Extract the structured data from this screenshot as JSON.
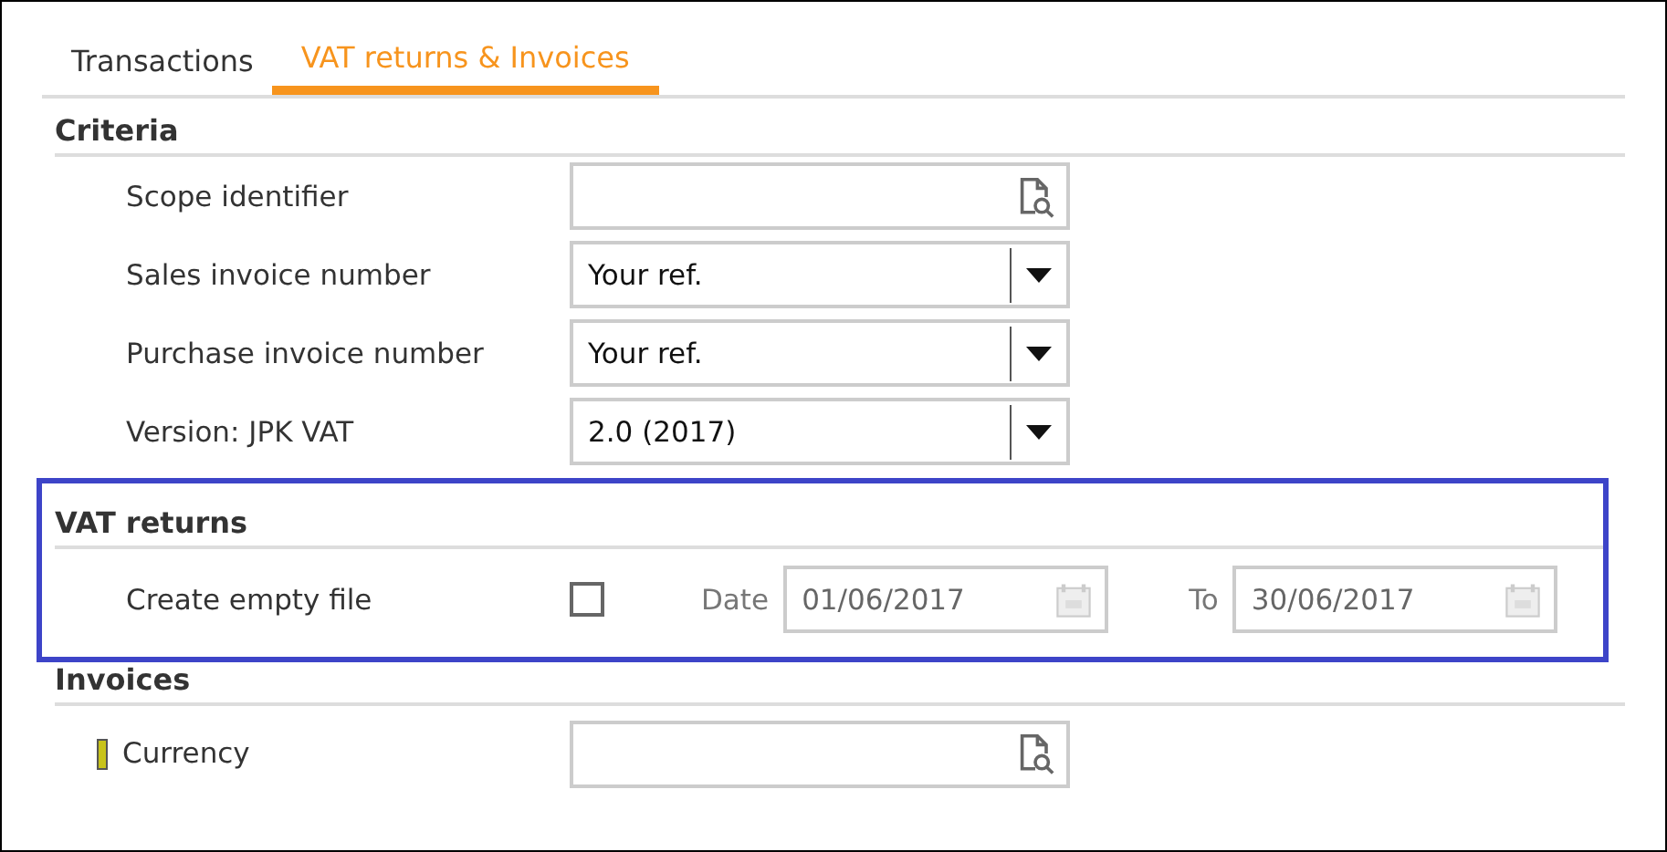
{
  "tabs": [
    {
      "label": "Transactions",
      "selected": false
    },
    {
      "label": "VAT returns & Invoices",
      "selected": true
    }
  ],
  "criteria": {
    "heading": "Criteria",
    "rows": [
      {
        "label": "Scope identifier",
        "kind": "lookup",
        "mandatory": false
      },
      {
        "label": "Sales invoice number",
        "kind": "dropdown",
        "value": "Your ref.",
        "mandatory": false
      },
      {
        "label": "Purchase invoice number",
        "kind": "dropdown",
        "value": "Your ref.",
        "mandatory": false
      },
      {
        "label": "Version: JPK VAT",
        "kind": "dropdown",
        "value": "2.0 (2017)",
        "mandatory": false
      }
    ]
  },
  "vat_returns": {
    "heading": "VAT returns",
    "highlighted": true,
    "label": "Create empty file",
    "checked": false,
    "date_label": "Date",
    "date_from": "01/06/2017",
    "to_label": "To",
    "date_to": "30/06/2017",
    "dates_disabled": true
  },
  "invoices": {
    "heading": "Invoices",
    "rows": [
      {
        "label": "Currency",
        "kind": "lookup",
        "mandatory": true
      }
    ]
  }
}
